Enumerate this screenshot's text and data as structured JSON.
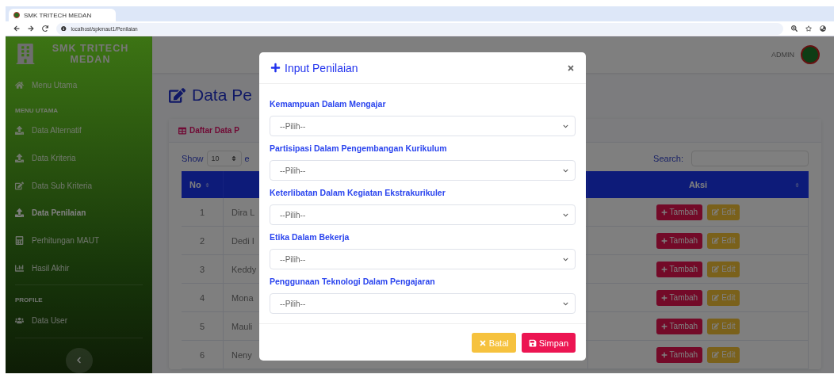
{
  "browser": {
    "tab_title": "SMK TRITECH MEDAN",
    "url": "localhost/spkmaut1/Penilaian"
  },
  "sidebar": {
    "brand": "SMK TRITECH MEDAN",
    "items": [
      {
        "kind": "link",
        "label": "Menu Utama",
        "selected": false
      },
      {
        "kind": "heading",
        "label": "MENU UTAMA"
      },
      {
        "kind": "link",
        "label": "Data Alternatif",
        "selected": false
      },
      {
        "kind": "link",
        "label": "Data Kriteria",
        "selected": false
      },
      {
        "kind": "link",
        "label": "Data Sub Kriteria",
        "selected": false
      },
      {
        "kind": "link",
        "label": "Data Penilaian",
        "selected": true
      },
      {
        "kind": "link",
        "label": "Perhitungan MAUT",
        "selected": false
      },
      {
        "kind": "link",
        "label": "Hasil Akhir",
        "selected": false
      },
      {
        "kind": "divider"
      },
      {
        "kind": "heading",
        "label": "PROFILE"
      },
      {
        "kind": "link",
        "label": "Data User",
        "selected": false
      },
      {
        "kind": "divider"
      }
    ]
  },
  "topbar": {
    "user": "ADMIN"
  },
  "page": {
    "title": "Data Pe",
    "card_title": "Daftar Data P",
    "show_label": "Show",
    "page_size": "10",
    "entries_label": "e",
    "search_label": "Search:",
    "columns": [
      "No",
      "Aksi"
    ],
    "rows": [
      {
        "no": "1",
        "name": "Dira L",
        "actions": [
          "Tambah",
          "Edit"
        ]
      },
      {
        "no": "2",
        "name": "Dedi I",
        "actions": [
          "Tambah",
          "Edit"
        ]
      },
      {
        "no": "3",
        "name": "Keddy",
        "actions": [
          "Tambah",
          "Edit"
        ]
      },
      {
        "no": "4",
        "name": "Mona",
        "actions": [
          "Tambah",
          "Edit"
        ]
      },
      {
        "no": "5",
        "name": "Mauli",
        "actions": [
          "Tambah",
          "Edit"
        ]
      },
      {
        "no": "6",
        "name": "Neny",
        "actions": [
          "Tambah",
          "Edit"
        ]
      }
    ]
  },
  "modal": {
    "title": "Input Penilaian",
    "fields": [
      {
        "label": "Kemampuan Dalam Mengajar",
        "value": "--Pilih--"
      },
      {
        "label": "Partisipasi Dalam Pengembangan Kurikulum",
        "value": "--Pilih--"
      },
      {
        "label": "Keterlibatan Dalam Kegiatan Ekstrakurikuler",
        "value": "--Pilih--"
      },
      {
        "label": "Etika Dalam Bekerja",
        "value": "--Pilih--"
      },
      {
        "label": "Penggunaan Teknologi Dalam Pengajaran",
        "value": "--Pilih--"
      }
    ],
    "buttons": [
      {
        "kind": "cancel",
        "label": "Batal"
      },
      {
        "kind": "save",
        "label": "Simpan"
      }
    ]
  }
}
